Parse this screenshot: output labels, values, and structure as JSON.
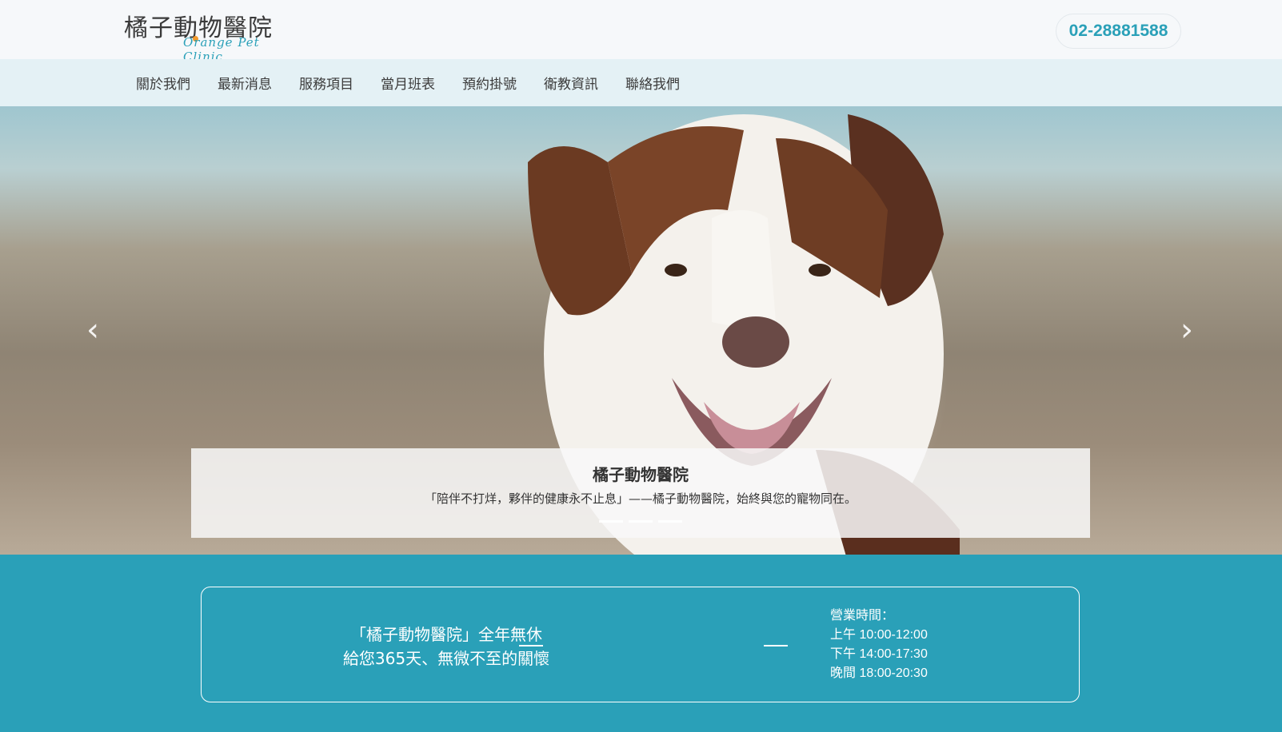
{
  "header": {
    "logo_cn": "橘子動物醫院",
    "logo_en": "Orange Pet Clinic",
    "phone": "02-28881588"
  },
  "nav": {
    "items": [
      "關於我們",
      "最新消息",
      "服務項目",
      "當月班表",
      "預約掛號",
      "衛教資訊",
      "聯絡我們"
    ]
  },
  "hero": {
    "caption_title": "橘子動物醫院",
    "caption_text": "「陪伴不打烊，夥伴的健康永不止息」——橘子動物醫院，始終與您的寵物同在。",
    "slides": 3,
    "active_slide": 1
  },
  "info": {
    "slogan_line1": "「橘子動物醫院」全年無休",
    "slogan_line2": "給您365天、無微不至的關懷",
    "hours_title": "營業時間：",
    "hours_morning": "上午  10:00-12:00",
    "hours_afternoon": "下午  14:00-17:30",
    "hours_evening": "晚間  18:00-20:30"
  },
  "colors": {
    "accent": "#2aa0b8",
    "header_bg": "#f6f8fa",
    "nav_bg": "#e4f1f5"
  }
}
